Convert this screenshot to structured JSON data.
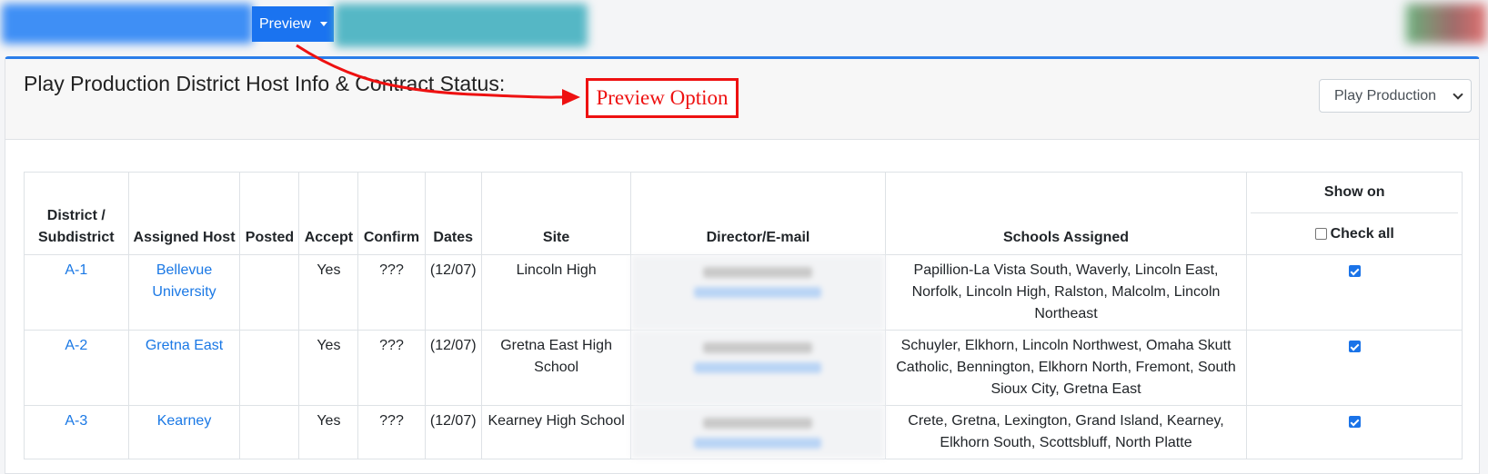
{
  "toolbar": {
    "preview_label": "Preview"
  },
  "page": {
    "title": "Play Production District Host Info & Contract Status:"
  },
  "activity_select": {
    "selected": "Play Production"
  },
  "annotation": {
    "label": "Preview Option",
    "color": "#ee1111"
  },
  "table": {
    "headers": {
      "district": "District / Subdistrict",
      "host": "Assigned Host",
      "posted": "Posted",
      "accept": "Accept",
      "confirm": "Confirm",
      "dates": "Dates",
      "site": "Site",
      "director": "Director/E-mail",
      "schools": "Schools Assigned",
      "show_on": "Show on",
      "check_all": "Check all"
    },
    "rows": [
      {
        "district": "A-1",
        "host": "Bellevue University",
        "posted": "",
        "accept": "Yes",
        "confirm": "???",
        "dates": "(12/07)",
        "site": "Lincoln High",
        "schools": "Papillion-La Vista South, Waverly, Lincoln East, Norfolk, Lincoln High, Ralston, Malcolm, Lincoln Northeast",
        "show": true
      },
      {
        "district": "A-2",
        "host": "Gretna East",
        "posted": "",
        "accept": "Yes",
        "confirm": "???",
        "dates": "(12/07)",
        "site": "Gretna East High School",
        "schools": "Schuyler, Elkhorn, Lincoln Northwest, Omaha Skutt Catholic, Bennington, Elkhorn North, Fremont, South Sioux City, Gretna East",
        "show": true
      },
      {
        "district": "A-3",
        "host": "Kearney",
        "posted": "",
        "accept": "Yes",
        "confirm": "???",
        "dates": "(12/07)",
        "site": "Kearney High School",
        "schools": "Crete, Gretna, Lexington, Grand Island, Kearney, Elkhorn South, Scottsbluff, North Platte",
        "show": true
      }
    ]
  },
  "colors": {
    "accent": "#1a73f0",
    "link": "#1a78e5",
    "card_border_top": "#2a7de9"
  }
}
